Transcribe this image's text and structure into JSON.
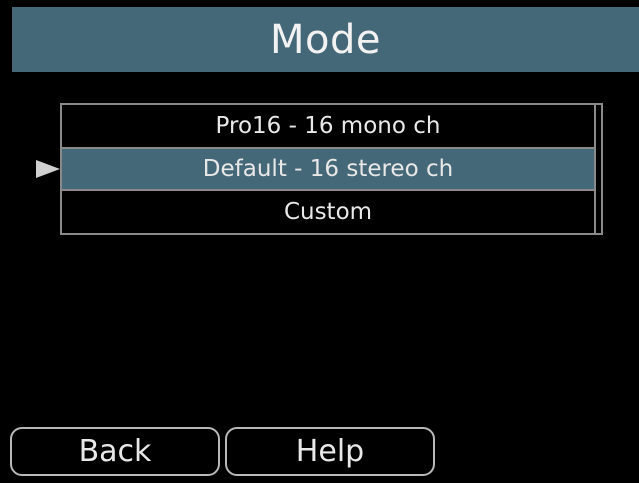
{
  "header": {
    "title": "Mode"
  },
  "list": {
    "items": [
      {
        "label": "Pro16 - 16 mono ch",
        "selected": false
      },
      {
        "label": "Default - 16 stereo ch",
        "selected": true
      },
      {
        "label": "Custom",
        "selected": false
      }
    ]
  },
  "footer": {
    "back_label": "Back",
    "help_label": "Help"
  },
  "colors": {
    "accent": "#456878",
    "background": "#000000",
    "text": "#e8e8e8",
    "border": "#8a8a8a"
  },
  "icons": {
    "pointer": "selection-pointer-icon"
  }
}
